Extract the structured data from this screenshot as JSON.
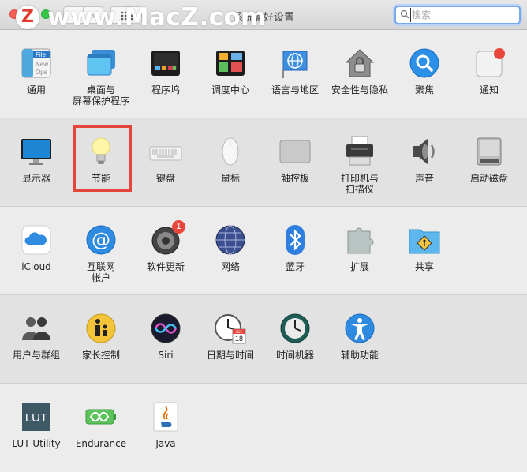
{
  "window": {
    "title": "系统偏好设置",
    "search_placeholder": "搜索",
    "watermark_logo": "Z",
    "watermark_text": "www.MacZ.com"
  },
  "navigation": {
    "back": "‹",
    "forward": "›"
  },
  "icons_legend": "semantic names mapped in data-name attributes",
  "sections": [
    {
      "panes": [
        {
          "id": "general",
          "label1": "通用",
          "label2": "",
          "icon": "general-icon"
        },
        {
          "id": "desktop",
          "label1": "桌面与",
          "label2": "屏幕保护程序",
          "icon": "desktop-icon"
        },
        {
          "id": "dock",
          "label1": "程序坞",
          "label2": "",
          "icon": "dock-icon"
        },
        {
          "id": "mission",
          "label1": "调度中心",
          "label2": "",
          "icon": "mission-control-icon"
        },
        {
          "id": "language",
          "label1": "语言与地区",
          "label2": "",
          "icon": "globe-flag-icon"
        },
        {
          "id": "security",
          "label1": "安全性与隐私",
          "label2": "",
          "icon": "house-lock-icon"
        },
        {
          "id": "spotlight",
          "label1": "聚焦",
          "label2": "",
          "icon": "spotlight-icon"
        },
        {
          "id": "notifications",
          "label1": "通知",
          "label2": "",
          "icon": "notifications-icon"
        }
      ]
    },
    {
      "panes": [
        {
          "id": "displays",
          "label1": "显示器",
          "label2": "",
          "icon": "display-icon"
        },
        {
          "id": "energy",
          "label1": "节能",
          "label2": "",
          "icon": "lightbulb-icon"
        },
        {
          "id": "keyboard",
          "label1": "键盘",
          "label2": "",
          "icon": "keyboard-icon"
        },
        {
          "id": "mouse",
          "label1": "鼠标",
          "label2": "",
          "icon": "mouse-icon"
        },
        {
          "id": "trackpad",
          "label1": "触控板",
          "label2": "",
          "icon": "trackpad-icon"
        },
        {
          "id": "printers",
          "label1": "打印机与",
          "label2": "扫描仪",
          "icon": "printer-icon"
        },
        {
          "id": "sound",
          "label1": "声音",
          "label2": "",
          "icon": "speaker-icon"
        },
        {
          "id": "startup",
          "label1": "启动磁盘",
          "label2": "",
          "icon": "disk-icon"
        }
      ]
    },
    {
      "panes": [
        {
          "id": "icloud",
          "label1": "iCloud",
          "label2": "",
          "icon": "icloud-icon"
        },
        {
          "id": "internet",
          "label1": "互联网",
          "label2": "帐户",
          "icon": "at-icon"
        },
        {
          "id": "update",
          "label1": "软件更新",
          "label2": "",
          "icon": "gear-update-icon",
          "badge": "1"
        },
        {
          "id": "network",
          "label1": "网络",
          "label2": "",
          "icon": "network-globe-icon"
        },
        {
          "id": "bluetooth",
          "label1": "蓝牙",
          "label2": "",
          "icon": "bluetooth-icon"
        },
        {
          "id": "extensions",
          "label1": "扩展",
          "label2": "",
          "icon": "puzzle-icon"
        },
        {
          "id": "sharing",
          "label1": "共享",
          "label2": "",
          "icon": "sharing-folder-icon"
        }
      ]
    },
    {
      "panes": [
        {
          "id": "users",
          "label1": "用户与群组",
          "label2": "",
          "icon": "users-icon"
        },
        {
          "id": "parental",
          "label1": "家长控制",
          "label2": "",
          "icon": "parental-icon"
        },
        {
          "id": "siri",
          "label1": "Siri",
          "label2": "",
          "icon": "siri-icon"
        },
        {
          "id": "datetime",
          "label1": "日期与时间",
          "label2": "",
          "icon": "clock-calendar-icon",
          "cal_month": "JUL",
          "cal_day": "18"
        },
        {
          "id": "timemachine",
          "label1": "时间机器",
          "label2": "",
          "icon": "time-machine-icon"
        },
        {
          "id": "accessibility",
          "label1": "辅助功能",
          "label2": "",
          "icon": "accessibility-icon"
        }
      ]
    },
    {
      "panes": [
        {
          "id": "lut",
          "label1": "LUT Utility",
          "label2": "",
          "icon": "lut-icon",
          "icon_text": "LUT"
        },
        {
          "id": "endurance",
          "label1": "Endurance",
          "label2": "",
          "icon": "battery-icon"
        },
        {
          "id": "java",
          "label1": "Java",
          "label2": "",
          "icon": "java-icon"
        }
      ]
    }
  ],
  "general_icon_text": [
    "File",
    "New",
    "Ope"
  ],
  "colors": {
    "highlight": "#e5463c",
    "search_focus": "#7aa8ea",
    "badge": "#e8453c"
  }
}
